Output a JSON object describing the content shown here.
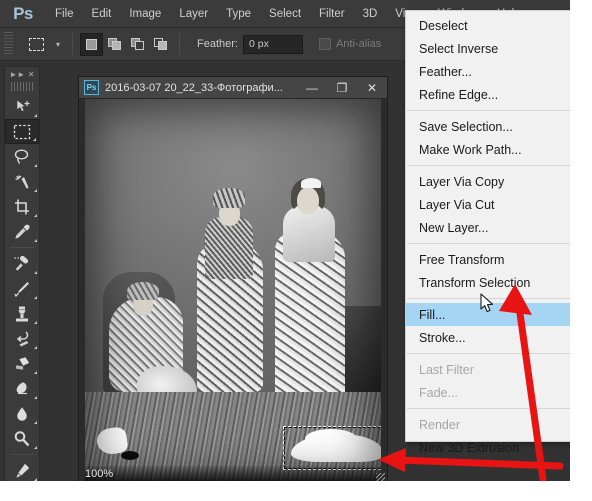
{
  "app": {
    "logo": "Ps",
    "menus": [
      "File",
      "Edit",
      "Image",
      "Layer",
      "Type",
      "Select",
      "Filter",
      "3D",
      "View",
      "Window",
      "Help"
    ]
  },
  "options_bar": {
    "tool_icon": "rectangular-marquee-icon",
    "selection_modes": [
      "new-selection",
      "add-to-selection",
      "subtract-from-selection",
      "intersect-with-selection"
    ],
    "active_mode": "new-selection",
    "feather_label": "Feather:",
    "feather_value": "0 px",
    "antialias_label": "Anti-alias",
    "antialias_checked": false
  },
  "tools_panel": {
    "collapse_icon": "double-chevron-icon",
    "close_icon": "close-icon",
    "tools": [
      {
        "name": "move-tool",
        "selected": false
      },
      {
        "name": "rectangular-marquee-tool",
        "selected": true
      },
      {
        "name": "lasso-tool",
        "selected": false
      },
      {
        "name": "magic-wand-tool",
        "selected": false
      },
      {
        "name": "crop-tool",
        "selected": false
      },
      {
        "name": "eyedropper-tool",
        "selected": false
      },
      {
        "name": "spot-healing-brush-tool",
        "selected": false
      },
      {
        "name": "brush-tool",
        "selected": false
      },
      {
        "name": "clone-stamp-tool",
        "selected": false
      },
      {
        "name": "history-brush-tool",
        "selected": false
      },
      {
        "name": "eraser-tool",
        "selected": false
      },
      {
        "name": "gradient-tool",
        "selected": false
      },
      {
        "name": "blur-tool",
        "selected": false
      },
      {
        "name": "dodge-tool",
        "selected": false
      },
      {
        "name": "pen-tool",
        "selected": false
      }
    ]
  },
  "document": {
    "title": "2016-03-07 20_22_33-Фотографи...",
    "icon": "Ps",
    "minimize": "—",
    "maximize": "❐",
    "close": "✕",
    "zoom_level": "100%",
    "photo_description": "Vintage black and white photograph of three women in ornate period costume"
  },
  "select_menu": {
    "title": "Select",
    "items": [
      {
        "label": "Deselect",
        "state": "normal"
      },
      {
        "label": "Select Inverse",
        "state": "normal"
      },
      {
        "label": "Feather...",
        "state": "normal"
      },
      {
        "label": "Refine Edge...",
        "state": "normal"
      },
      {
        "separator": true
      },
      {
        "label": "Save Selection...",
        "state": "normal"
      },
      {
        "label": "Make Work Path...",
        "state": "normal"
      },
      {
        "separator": true
      },
      {
        "label": "Layer Via Copy",
        "state": "normal"
      },
      {
        "label": "Layer Via Cut",
        "state": "normal"
      },
      {
        "label": "New Layer...",
        "state": "normal"
      },
      {
        "separator": true
      },
      {
        "label": "Free Transform",
        "state": "normal"
      },
      {
        "label": "Transform Selection",
        "state": "normal"
      },
      {
        "separator": true
      },
      {
        "label": "Fill...",
        "state": "highlighted"
      },
      {
        "label": "Stroke...",
        "state": "normal"
      },
      {
        "separator": true
      },
      {
        "label": "Last Filter",
        "state": "disabled"
      },
      {
        "label": "Fade...",
        "state": "disabled"
      },
      {
        "separator": true
      },
      {
        "label": "Render",
        "state": "disabled"
      },
      {
        "label": "New 3D Extrusion",
        "state": "normal"
      }
    ]
  },
  "annotations": {
    "arrow_to_fill": "red-arrow-pointing-to-fill-menu-item",
    "arrow_to_selection": "red-arrow-pointing-to-marquee-selection",
    "cursor": "mouse-pointer-cursor"
  },
  "colors": {
    "menu_highlight": "#a5d5f2",
    "panel_bg": "#3b3b3b",
    "menu_bg": "#f1f1f1",
    "annotation_red": "#e81313",
    "logo_blue": "#a7c4d8"
  }
}
